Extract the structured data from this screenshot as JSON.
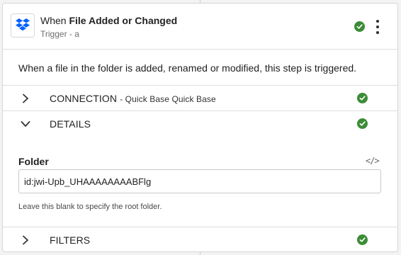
{
  "colors": {
    "accent_green": "#3c8c37",
    "dropbox_blue": "#0061fe"
  },
  "header": {
    "app_icon": "dropbox-icon",
    "title_prefix": "When",
    "title_bold": "File Added or Changed",
    "subtitle": "Trigger - a",
    "status_icon": "check-circle-icon",
    "menu_icon": "kebab-menu-icon"
  },
  "description": "When a file in the folder is added, renamed or modified, this step is triggered.",
  "sections": {
    "connection": {
      "label": "CONNECTION",
      "sublabel": "- Quick Base Quick Base",
      "expanded": false
    },
    "details": {
      "label": "DETAILS",
      "expanded": true,
      "field_label": "Folder",
      "code_icon": "</>",
      "folder_value": "id:jwi-Upb_UHAAAAAAAABFlg",
      "hint": "Leave this blank to specify the root folder."
    },
    "filters": {
      "label": "FILTERS",
      "expanded": false
    }
  }
}
